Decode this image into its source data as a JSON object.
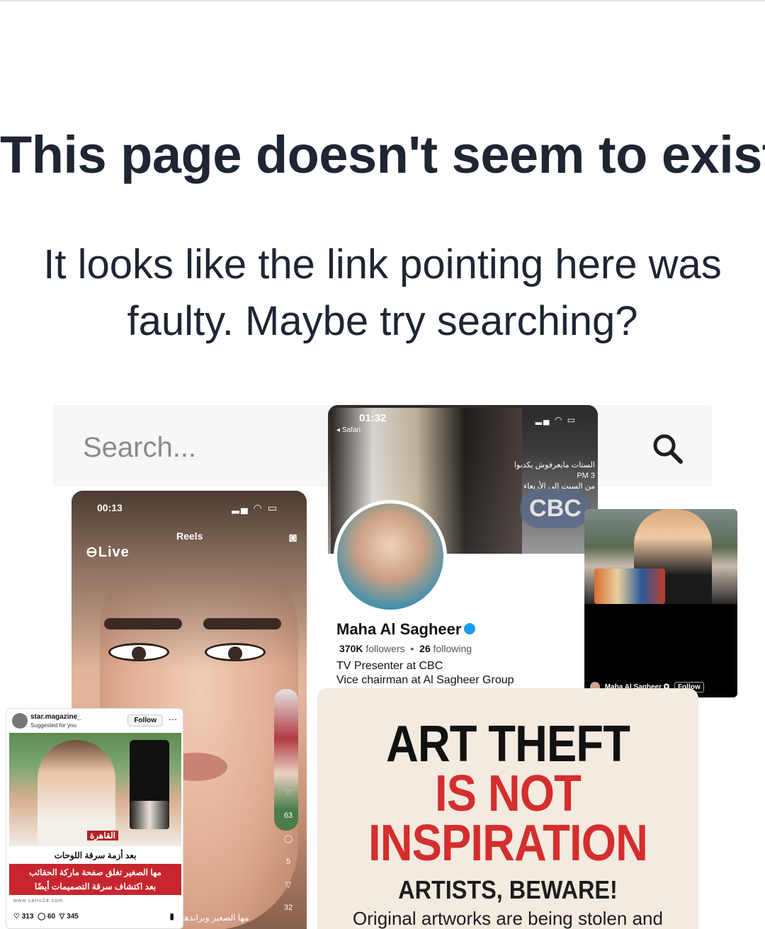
{
  "error": {
    "title": "This page doesn't seem to exist.",
    "message": "It looks like the link pointing here was faulty. Maybe try searching?"
  },
  "search": {
    "placeholder": "Search...",
    "value": ""
  },
  "reel_card": {
    "time": "00:13",
    "section": "Reels",
    "live_label": "Live",
    "counts": [
      "63",
      "5",
      "32"
    ],
    "caption": "مها الصغير وبراندها"
  },
  "profile_card": {
    "time": "01:32",
    "browser": "Safari",
    "promo_text": "الستات مايعرفوش يكدبوا",
    "promo_time": "3 PM",
    "promo_days": "من السبت إلى الأربعاء",
    "channel_logo": "CBC",
    "name": "Maha Al Sagheer",
    "followers_count": "370K",
    "followers_label": "followers",
    "following_count": "26",
    "following_label": "following",
    "bio_line1": "TV Presenter at CBC",
    "bio_line2": "Vice chairman at Al Sagheer Group"
  },
  "tv_card": {
    "account_name": "Maha Al Sagheer",
    "follow_label": "Follow"
  },
  "poster": {
    "line1": "ART THEFT",
    "line2": "IS NOT",
    "line3": "INSPIRATION",
    "line4": "ARTISTS, BEWARE!",
    "line5": "Original artworks are being stolen and"
  },
  "star_card": {
    "account": "star.magazine_",
    "suggested": "Suggested for you",
    "follow_label": "Follow",
    "logo_text": "القاهرة",
    "headline_top": "بعد أزمة سرقة اللوحات",
    "headline_main1": "مها الصغير تغلق صفحة ماركة الحقائب",
    "headline_main2": "بعد اكتشاف سرقة التصميمات أيضًا",
    "site": "www.cairo24.com",
    "likes": "313",
    "comments": "60",
    "shares": "345"
  },
  "colors": {
    "text": "#1f2533",
    "search_bg": "#f7f7f7",
    "poster_red": "#d42e2e",
    "poster_bg": "#f3eae0",
    "verified_blue": "#1d9bf0"
  }
}
